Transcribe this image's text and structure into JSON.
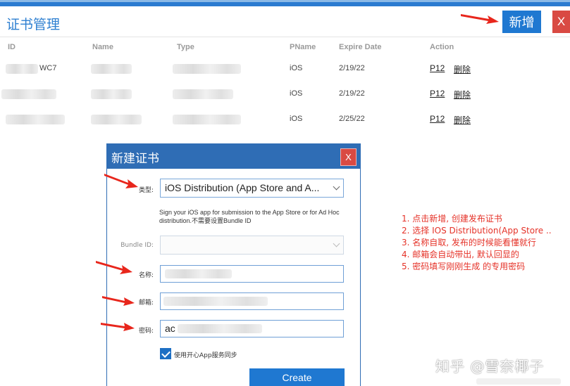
{
  "header": {
    "title": "证书管理",
    "add_label": "新增",
    "close_label": "X"
  },
  "table": {
    "columns": [
      "ID",
      "Name",
      "Type",
      "PName",
      "Expire Date",
      "Action"
    ],
    "rows": [
      {
        "id_visible": "WC7",
        "pname": "iOS",
        "expire": "2/19/22",
        "p12": "P12",
        "delete": "删除"
      },
      {
        "id_visible": "",
        "pname": "iOS",
        "expire": "2/19/22",
        "p12": "P12",
        "delete": "删除"
      },
      {
        "id_visible": "",
        "pname": "iOS",
        "expire": "2/25/22",
        "p12": "P12",
        "delete": "删除"
      }
    ]
  },
  "dialog": {
    "title": "新建证书",
    "close_label": "X",
    "type_label": "类型:",
    "type_value": "iOS Distribution (App Store and A...",
    "type_hint": "Sign your iOS app for submission to the App Store or for Ad Hoc distribution.不需要设置Bundle ID",
    "bundle_label": "Bundle ID:",
    "bundle_value": "",
    "name_label": "名称:",
    "name_value": "",
    "email_label": "邮箱:",
    "email_value": "",
    "password_label": "密码:",
    "password_value": "ac",
    "sync_checked": true,
    "sync_label": "使用开心App服务同步",
    "create_label": "Create"
  },
  "notes": [
    "1. 点击新增, 创建发布证书",
    "2. 选择 IOS Distribution(App Store ..",
    "3. 名称自取, 发布的时候能看懂就行",
    "4. 邮箱会自动带出, 默认回显的",
    "5. 密码填写刚刚生成 的专用密码"
  ],
  "watermark": "知乎 @雪奈椰子",
  "colors": {
    "primary": "#1f78d1",
    "dialog_header": "#2f6db5",
    "danger": "#d94a43",
    "annotation": "#e53228"
  }
}
